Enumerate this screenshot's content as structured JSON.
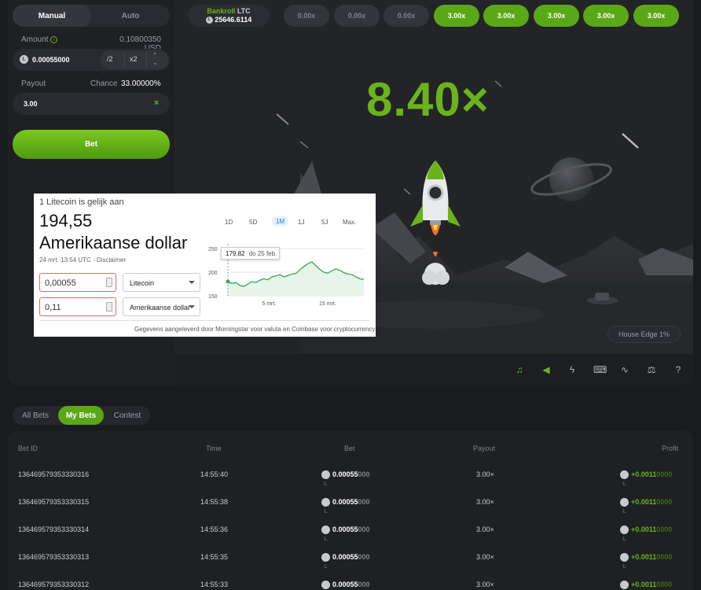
{
  "mode_tabs": {
    "manual": "Manual",
    "auto": "Auto"
  },
  "amount": {
    "label": "Amount",
    "value_usd": "0.10800350 USD",
    "value": "0.00055000",
    "half": "/2",
    "double": "x2"
  },
  "payout": {
    "label": "Payout",
    "chance_label": "Chance",
    "chance_value": "33.00000%",
    "value": "3.00"
  },
  "bet_button": "Bet",
  "bankroll": {
    "label": "Bankroll",
    "currency": "LTC",
    "value": "25646.6114"
  },
  "history": [
    {
      "label": "0.00x",
      "win": false
    },
    {
      "label": "0.00x",
      "win": false
    },
    {
      "label": "0.00x",
      "win": false
    },
    {
      "label": "3.00x",
      "win": true
    },
    {
      "label": "3.00x",
      "win": true
    },
    {
      "label": "3.00x",
      "win": true
    },
    {
      "label": "3.00x",
      "win": true
    },
    {
      "label": "3.00x",
      "win": true
    }
  ],
  "multiplier": "8.40×",
  "house_edge": "House Edge 1%",
  "toolbar_icons": [
    "music-icon",
    "sound-icon",
    "lightning-icon",
    "keyboard-icon",
    "chart-icon",
    "fairness-icon",
    "help-icon"
  ],
  "converter": {
    "heading": "1 Litecoin is gelijk aan",
    "amount": "194,55",
    "currency": "Amerikaanse dollar",
    "timestamp": "24 mrt. 13:54 UTC · Disclaimer",
    "ranges": [
      "1D",
      "5D",
      "1M",
      "1J",
      "5J",
      "Max."
    ],
    "active_range": "1M",
    "from_value": "0,00055",
    "from_currency": "Litecoin",
    "to_value": "0,11",
    "to_currency": "Amerikaanse dollar",
    "source": "Gegevens aangeleverd door Morningstar voor valuta en Coinbase voor cryptocurrency",
    "tooltip_value": "179,82",
    "tooltip_date": "do 25 feb."
  },
  "chart_data": {
    "type": "line",
    "x_ticks": [
      "5 mrt.",
      "15 mrt."
    ],
    "y_ticks": [
      150,
      200,
      250
    ],
    "ylim": [
      150,
      260
    ],
    "values": [
      180,
      176,
      178,
      172,
      170,
      175,
      180,
      178,
      183,
      186,
      184,
      190,
      192,
      195,
      190,
      193,
      196,
      197,
      205,
      212,
      218,
      222,
      214,
      206,
      200,
      198,
      203,
      207,
      204,
      199,
      196,
      195,
      190,
      186,
      185
    ]
  },
  "bet_tabs": {
    "all": "All Bets",
    "mine": "My Bets",
    "contest": "Contest"
  },
  "table": {
    "headers": {
      "id": "Bet ID",
      "time": "Time",
      "bet": "Bet",
      "payout": "Payout",
      "profit": "Profit"
    },
    "rows": [
      {
        "id": "136469579353330316",
        "time": "14:55:40",
        "bet_main": "0.00055",
        "bet_dim": "000",
        "payout": "3.00×",
        "profit_main": "+0.0011",
        "profit_dim": "0000"
      },
      {
        "id": "136469579353330315",
        "time": "14:55:38",
        "bet_main": "0.00055",
        "bet_dim": "000",
        "payout": "3.00×",
        "profit_main": "+0.0011",
        "profit_dim": "0000"
      },
      {
        "id": "136469579353330314",
        "time": "14:55:36",
        "bet_main": "0.00055",
        "bet_dim": "000",
        "payout": "3.00×",
        "profit_main": "+0.0011",
        "profit_dim": "0000"
      },
      {
        "id": "136469579353330313",
        "time": "14:55:35",
        "bet_main": "0.00055",
        "bet_dim": "000",
        "payout": "3.00×",
        "profit_main": "+0.0011",
        "profit_dim": "0000"
      },
      {
        "id": "136469579353330312",
        "time": "14:55:33",
        "bet_main": "0.00055",
        "bet_dim": "000",
        "payout": "3.00×",
        "profit_main": "+0.0011",
        "profit_dim": "0000"
      }
    ]
  }
}
